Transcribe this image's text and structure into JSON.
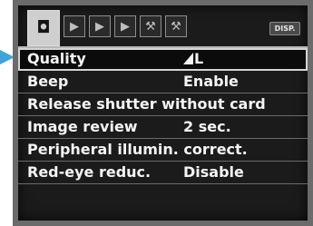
{
  "header": {
    "tabs": [
      {
        "icon": "camera-icon",
        "glyph": "◘",
        "active": true
      },
      {
        "icon": "play-icon",
        "glyph": "▶",
        "active": false
      },
      {
        "icon": "play-2-icon",
        "glyph": "▶",
        "active": false
      },
      {
        "icon": "play-3-icon",
        "glyph": "▶",
        "active": false
      },
      {
        "icon": "tool-icon",
        "glyph": "⚒",
        "active": false
      },
      {
        "icon": "tool-2-icon",
        "glyph": "⚒",
        "active": false
      }
    ],
    "disp_label": "DISP."
  },
  "menu": {
    "items": [
      {
        "label": "Quality",
        "value": "L"
      },
      {
        "label": "Beep",
        "value": "Enable"
      },
      {
        "label": "Release shutter without card",
        "value": ""
      },
      {
        "label": "Image review",
        "value": "2 sec."
      },
      {
        "label": "Peripheral illumin. correct.",
        "value": ""
      },
      {
        "label": "Red-eye reduc.",
        "value": "Disable"
      }
    ]
  },
  "colors": {
    "pointer": "#3aa6e0",
    "selected_outline": "#d4d4d4"
  }
}
